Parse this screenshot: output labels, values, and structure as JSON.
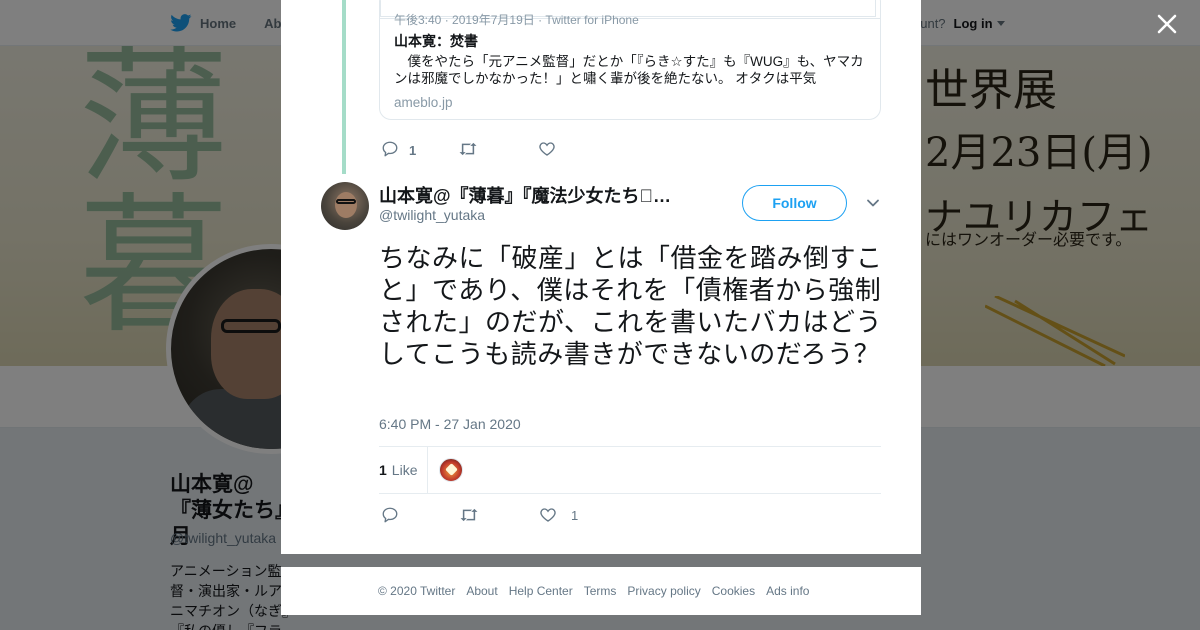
{
  "topbar": {
    "home_label": "Home",
    "about_label_cut": "Abo",
    "account_prompt_cut": "ccount?",
    "login_label": "Log in"
  },
  "banner": {
    "vertical_text": "薄暮",
    "line1": "世界展",
    "line2": "2月23日(月)",
    "line3": "ナユリカフェ",
    "line4": "にはワンオーダー必要です。"
  },
  "profile": {
    "name": "山本寛@『薄暮』『魔法少女たち』",
    "name_display_cut": "山本寛@『薄女たち』月",
    "handle": "@twilight_yutaka",
    "bio_cut": "アニメーション監督・演出家・ルアニマチオン（なぎ』『私の優し『フラクタル』『戦勇』『Wake Up"
  },
  "quoted_card": {
    "cut_line": "午後3:40 · 2019年7月19日 · Twitter for iPhone",
    "title": "山本寛：焚書",
    "description": "　僕をやたら「元アニメ監督」だとか「『らき☆すた』も『WUG』も、ヤマカンは邪魔でしかなかった！」と嘯く輩が後を絶たない。 オタクは平気",
    "domain": "ameblo.jp"
  },
  "prev_tweet_actions": {
    "reply_count": "1",
    "retweet_count": "",
    "like_count": ""
  },
  "tweet": {
    "author_name": "山本寛@『薄暮』『魔法少女たち\u0000…",
    "author_handle": "@twilight_yutaka",
    "follow_label": "Follow",
    "text": "ちなみに「破産」とは「借金を踏み倒すこと」であり、僕はそれを「債権者から強制された」のだが、これを書いたバカはどうしてこうも読み書きができないのだろう？",
    "timestamp": "6:40 PM - 27 Jan 2020",
    "likes_count": "1",
    "likes_label": "Like",
    "action_like_count": "1"
  },
  "footer": {
    "links": [
      "© 2020 Twitter",
      "About",
      "Help Center",
      "Terms",
      "Privacy policy",
      "Cookies",
      "Ads info"
    ]
  },
  "colors": {
    "twitter_blue": "#1da1f2",
    "thread_line": "#a5dcc8",
    "overlay": "rgba(0,0,0,0.5)",
    "muted_text": "#657786"
  },
  "icons": [
    "twitter-bird-icon",
    "caret-down-icon",
    "close-icon",
    "reply-icon",
    "retweet-icon",
    "heart-icon",
    "chevron-down-icon"
  ]
}
